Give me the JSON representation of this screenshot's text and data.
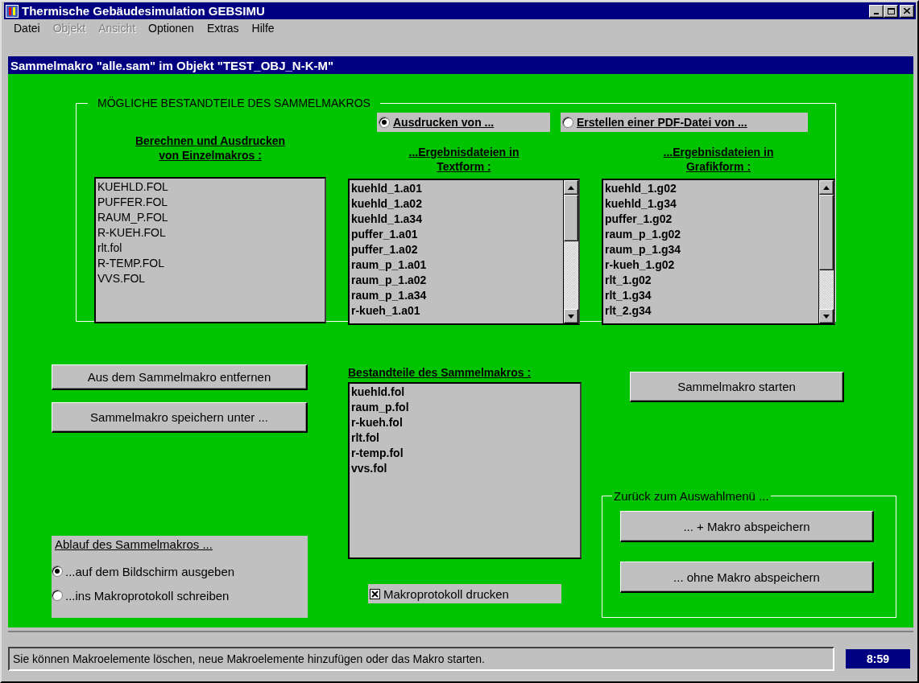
{
  "window": {
    "title": "Thermische Gebäudesimulation GEBSIMU"
  },
  "menu": [
    {
      "label": "Datei",
      "disabled": false
    },
    {
      "label": "Objekt",
      "disabled": true
    },
    {
      "label": "Ansicht",
      "disabled": true
    },
    {
      "label": "Optionen",
      "disabled": false
    },
    {
      "label": "Extras",
      "disabled": false
    },
    {
      "label": "Hilfe",
      "disabled": false
    }
  ],
  "subtitle": "Sammelmakro \"alle.sam\" im Objekt \"TEST_OBJ_N-K-M\"",
  "components": {
    "title": "MÖGLICHE BESTANDTEILE DES SAMMELMAKROS",
    "output_options": [
      {
        "label": "Ausdrucken von ...",
        "selected": true
      },
      {
        "label": "Erstellen einer PDF-Datei von ...",
        "selected": false
      }
    ],
    "lists": [
      {
        "kind": "plain",
        "heading": [
          "Berechnen und Ausdrucken",
          "von Einzelmakros :"
        ],
        "items": [
          "KUEHLD.FOL",
          "PUFFER.FOL",
          "RAUM_P.FOL",
          "R-KUEH.FOL",
          "rlt.fol",
          "R-TEMP.FOL",
          "VVS.FOL"
        ]
      },
      {
        "kind": "scroll",
        "heading": [
          "...Ergebnisdateien in",
          "Textform :"
        ],
        "items": [
          "kuehld_1.a01",
          "kuehld_1.a02",
          "kuehld_1.a34",
          "puffer_1.a01",
          "puffer_1.a02",
          "raum_p_1.a01",
          "raum_p_1.a02",
          "raum_p_1.a34",
          "r-kueh_1.a01"
        ]
      },
      {
        "kind": "scroll",
        "heading": [
          "...Ergebnisdateien in",
          "Grafikform :"
        ],
        "items": [
          "kuehld_1.g02",
          "kuehld_1.g34",
          "puffer_1.g02",
          "raum_p_1.g02",
          "raum_p_1.g34",
          "r-kueh_1.g02",
          "rlt_1.g02",
          "rlt_1.g34",
          "rlt_2.g34"
        ]
      }
    ]
  },
  "edit_buttons": [
    "Aus dem Sammelmakro entfernen",
    "Sammelmakro speichern unter ..."
  ],
  "run_mode": {
    "title": "Ablauf des Sammelmakros ...",
    "options": [
      {
        "label": "...auf dem Bildschirm ausgeben",
        "selected": true
      },
      {
        "label": "...ins Makroprotokoll schreiben",
        "selected": false
      }
    ]
  },
  "members": {
    "heading": "Bestandteile des Sammelmakros :",
    "items": [
      "kuehld.fol",
      "raum_p.fol",
      "r-kueh.fol",
      "rlt.fol",
      "r-temp.fol",
      "vvs.fol"
    ]
  },
  "protocol_checkbox": {
    "label": "Makroprotokoll drucken",
    "checked": true
  },
  "start_button": "Sammelmakro starten",
  "back_group": {
    "title": "Zurück zum Auswahlmenü ...",
    "buttons": [
      "... + Makro abspeichern",
      "... ohne Makro abspeichern"
    ]
  },
  "status_bar": {
    "message": "Sie können Makroelemente löschen, neue Makroelemente hinzufügen oder das Makro starten.",
    "time": "8:59"
  }
}
